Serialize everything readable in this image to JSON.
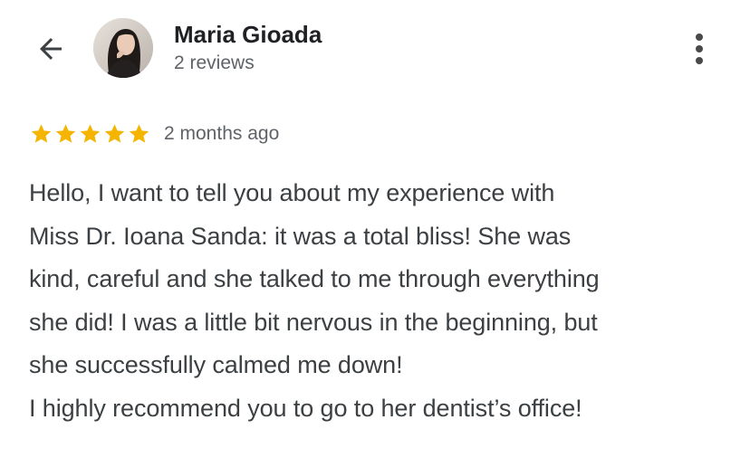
{
  "header": {
    "back_icon": "arrow-left-icon",
    "author_name": "Maria Gioada",
    "author_reviews": "2 reviews",
    "more_icon": "more-vertical-icon"
  },
  "review": {
    "rating": 5,
    "rating_max": 5,
    "star_color": "#f4b400",
    "date": "2 months ago",
    "lines": [
      "Hello, I want to tell you about my experience with",
      "Miss Dr. Ioana Sanda: it was a total bliss! She was",
      "kind, careful and she talked to me through everything",
      "she did! I was a little bit nervous in the beginning, but",
      "she successfully calmed me down!",
      "I highly recommend you to go to her dentist’s office!"
    ]
  }
}
